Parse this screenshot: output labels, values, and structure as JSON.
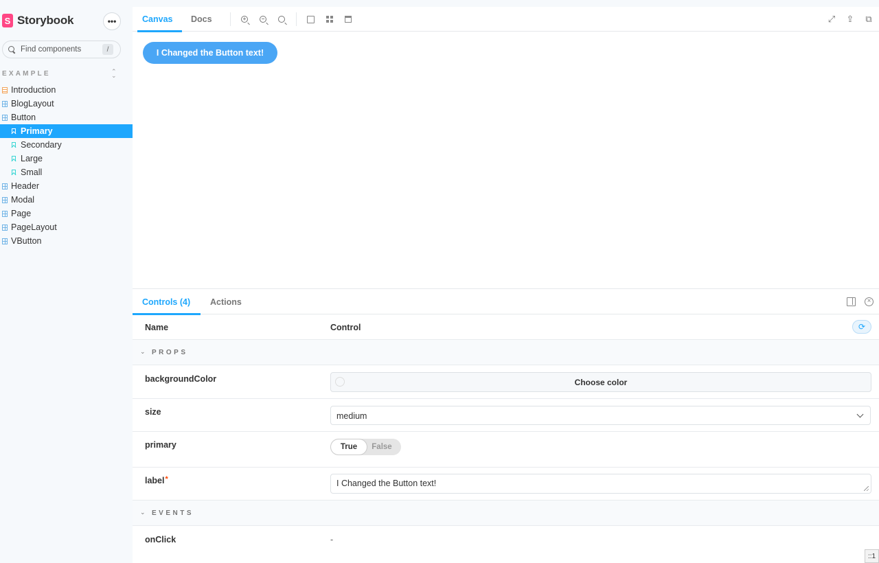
{
  "app": {
    "name": "Storybook",
    "logo_letter": "S",
    "menu_label": "•••"
  },
  "search": {
    "placeholder": "Find components",
    "shortcut": "/"
  },
  "sidebar": {
    "section": "EXAMPLE",
    "items": [
      {
        "label": "Introduction",
        "kind": "doc"
      },
      {
        "label": "BlogLayout",
        "kind": "component"
      },
      {
        "label": "Button",
        "kind": "component"
      },
      {
        "label": "Primary",
        "kind": "story",
        "selected": true
      },
      {
        "label": "Secondary",
        "kind": "story"
      },
      {
        "label": "Large",
        "kind": "story"
      },
      {
        "label": "Small",
        "kind": "story"
      },
      {
        "label": "Header",
        "kind": "component"
      },
      {
        "label": "Modal",
        "kind": "component"
      },
      {
        "label": "Page",
        "kind": "component"
      },
      {
        "label": "PageLayout",
        "kind": "component"
      },
      {
        "label": "VButton",
        "kind": "component"
      }
    ]
  },
  "toolbar": {
    "tabs": [
      "Canvas",
      "Docs"
    ],
    "active_tab": "Canvas",
    "tools": [
      "zoom-in-icon",
      "zoom-out-icon",
      "zoom-reset-icon",
      "background-icon",
      "grid-icon",
      "outline-icon"
    ],
    "right_tools": [
      "fullscreen-icon",
      "share-icon",
      "copy-link-icon"
    ]
  },
  "canvas": {
    "button_label": "I Changed the Button text!",
    "button_color": "#4aa6f5"
  },
  "addons": {
    "tabs": [
      "Controls (4)",
      "Actions"
    ],
    "active_tab": "Controls (4)",
    "columns": {
      "name": "Name",
      "control": "Control"
    },
    "sections": {
      "props": "PROPS",
      "events": "EVENTS"
    },
    "props": {
      "backgroundColor": {
        "name": "backgroundColor",
        "control_label": "Choose color"
      },
      "size": {
        "name": "size",
        "value": "medium"
      },
      "primary": {
        "name": "primary",
        "true_label": "True",
        "false_label": "False",
        "value": true
      },
      "label": {
        "name": "label",
        "required_mark": "*",
        "value": "I Changed the Button text!"
      }
    },
    "events": {
      "onClick": {
        "name": "onClick",
        "value": "-"
      }
    }
  },
  "corner_badge": "::1",
  "colors": {
    "accent": "#1ea7fd",
    "brand": "#ff4785"
  }
}
